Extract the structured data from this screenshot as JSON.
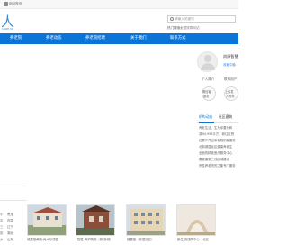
{
  "topbar": {
    "home_label": "网站首页"
  },
  "header": {
    "search_placeholder": "请输入关键词",
    "hot_label": "热门搜索：",
    "hot_value": "全国殡葬网站"
  },
  "nav": {
    "items": [
      {
        "label": "养老院"
      },
      {
        "label": "养老动态"
      },
      {
        "label": "养老院招聘"
      },
      {
        "label": "关于我们"
      },
      {
        "label": "联系方式"
      }
    ]
  },
  "profile": {
    "name": "尚康智慧",
    "link": "收藏中心",
    "link2": "多",
    "stats": [
      "个人简介",
      "联系用户"
    ],
    "actions": [
      {
        "line1": "微信客",
        "line2": "服务"
      },
      {
        "line1": "上传发",
        "line2": "入资料"
      }
    ],
    "tabs": [
      "机构动态",
      "社区建筑"
    ],
    "lines": [
      "养老生活，生为你要为和",
      "滨州1956平方，新住区院",
      "位置平洋过来老院的最服务",
      "北新城居民区健康养老生",
      "全面的精准医疗服务中心",
      "要健康第三住区域建设",
      "杀性养老院的之集专门服务"
    ]
  },
  "left_list": {
    "items": [
      "小",
      "平",
      "三",
      "庆",
      "乡",
      "广"
    ],
    "right_items": [
      "黑龙",
      "内蒙",
      "辽宁",
      "湖北",
      "山东",
      "广东"
    ]
  },
  "photos": [
    {
      "caption": "城建型养院·尚大尔康园"
    },
    {
      "caption": "智胜 养护院院（新 新城）"
    },
    {
      "caption": "福要型（老居民区）"
    },
    {
      "caption": "新生 安康院中心（北区"
    }
  ],
  "colors": {
    "nav_bg": "#0b74d9",
    "accent": "#3b8ad8"
  }
}
